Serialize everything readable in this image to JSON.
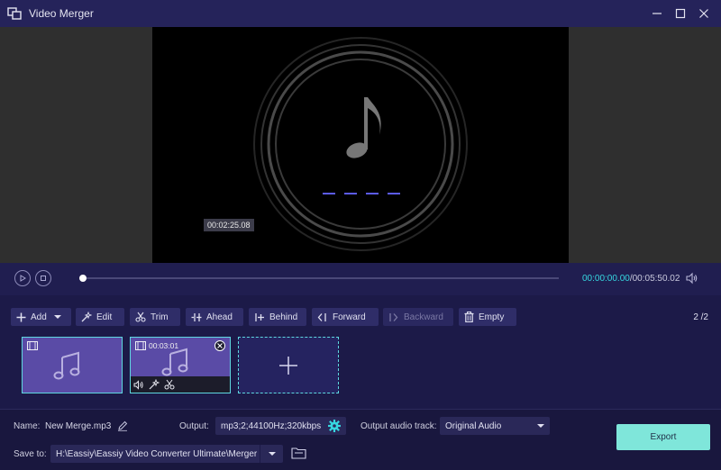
{
  "window": {
    "title": "Video Merger",
    "icons": {
      "app": "merge-icon",
      "minimize": "minimize-icon",
      "maximize": "maximize-icon",
      "close": "close-icon"
    }
  },
  "preview": {
    "timestamp": "00:02:25.08",
    "icons": {
      "artwork": "music-note-icon"
    },
    "colors": {
      "dashes": "#5b5bf0"
    }
  },
  "player": {
    "time_current": "00:00:00.00",
    "time_total": "/00:05:50.02",
    "progress": 0,
    "icons": {
      "play": "play-icon",
      "stop": "stop-icon",
      "volume": "volume-icon"
    }
  },
  "toolbar": {
    "add_label": "Add",
    "edit_label": "Edit",
    "trim_label": "Trim",
    "ahead_label": "Ahead",
    "behind_label": "Behind",
    "forward_label": "Forward",
    "backward_label": "Backward",
    "empty_label": "Empty",
    "page_counter": "2 /2"
  },
  "clips": [
    {
      "duration": "",
      "icons": [
        "film-icon",
        "music-note-icon"
      ]
    },
    {
      "duration": "00:03:01",
      "icons": [
        "film-icon",
        "music-note-icon",
        "remove-icon",
        "volume-icon",
        "edit-icon",
        "trim-icon"
      ]
    }
  ],
  "footer": {
    "name_label": "Name:",
    "name_value": "New Merge.mp3",
    "output_label": "Output:",
    "output_value": "mp3;2;44100Hz;320kbps",
    "audio_track_label": "Output audio track:",
    "audio_track_value": "Original Audio",
    "save_to_label": "Save to:",
    "save_to_value": "H:\\Eassiy\\Eassiy Video Converter Ultimate\\Merger",
    "export_label": "Export",
    "colors": {
      "export": "#7fe6da",
      "accent": "#36d6e0"
    }
  }
}
